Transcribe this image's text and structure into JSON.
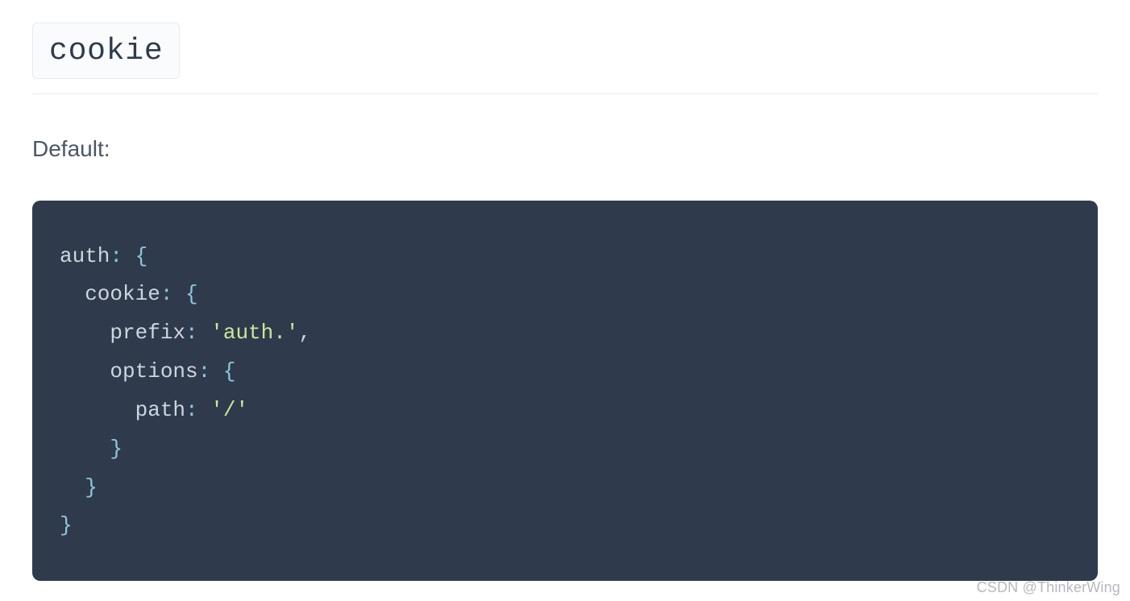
{
  "header": {
    "title": "cookie"
  },
  "label": "Default:",
  "code": {
    "lines": [
      [
        {
          "cls": "tok-key",
          "t": "auth"
        },
        {
          "cls": "tok-punc",
          "t": ": "
        },
        {
          "cls": "tok-brace",
          "t": "{"
        }
      ],
      [
        {
          "cls": "tok-key",
          "t": "  cookie"
        },
        {
          "cls": "tok-punc",
          "t": ": "
        },
        {
          "cls": "tok-brace",
          "t": "{"
        }
      ],
      [
        {
          "cls": "tok-key",
          "t": "    prefix"
        },
        {
          "cls": "tok-punc",
          "t": ": "
        },
        {
          "cls": "tok-string",
          "t": "'auth.'"
        },
        {
          "cls": "tok-comma",
          "t": ","
        }
      ],
      [
        {
          "cls": "tok-key",
          "t": "    options"
        },
        {
          "cls": "tok-punc",
          "t": ": "
        },
        {
          "cls": "tok-brace",
          "t": "{"
        }
      ],
      [
        {
          "cls": "tok-key",
          "t": "      path"
        },
        {
          "cls": "tok-punc",
          "t": ": "
        },
        {
          "cls": "tok-string",
          "t": "'/'"
        }
      ],
      [
        {
          "cls": "tok-brace",
          "t": "    }"
        }
      ],
      [
        {
          "cls": "tok-brace",
          "t": "  }"
        }
      ],
      [
        {
          "cls": "tok-brace",
          "t": "}"
        }
      ]
    ]
  },
  "watermark": "CSDN @ThinkerWing"
}
